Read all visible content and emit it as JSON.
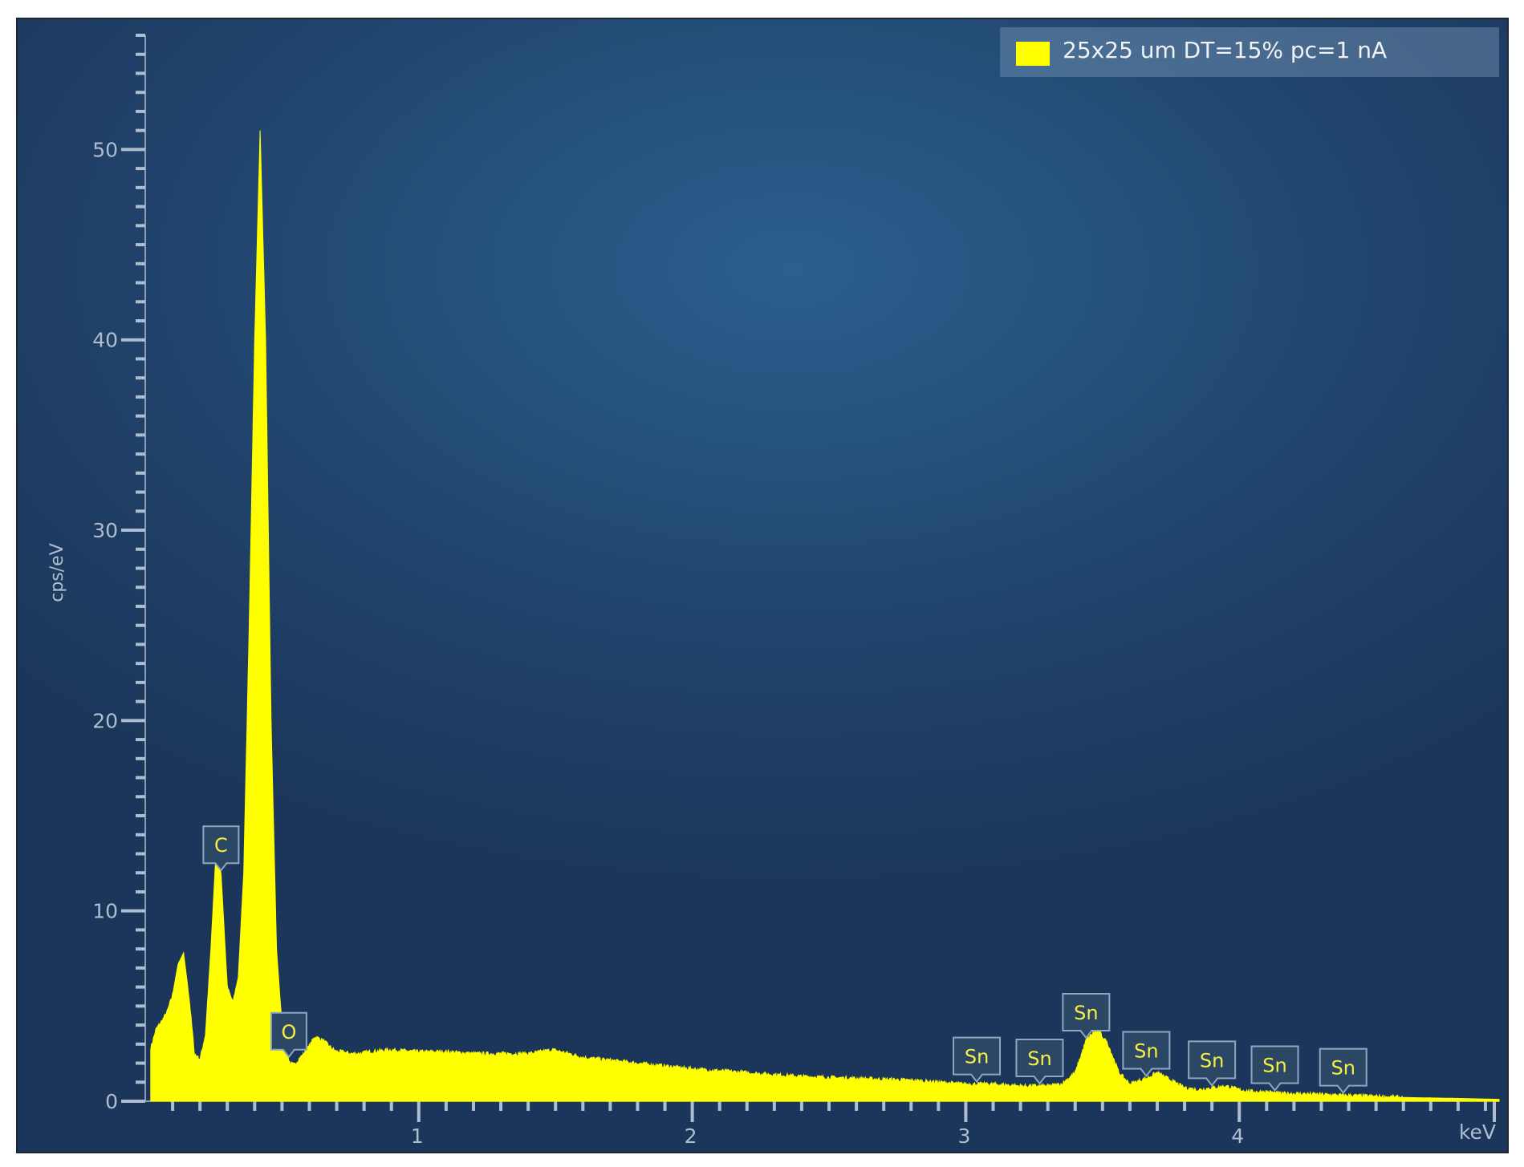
{
  "chart_data": {
    "type": "area",
    "title": "",
    "xlabel": "keV",
    "ylabel": "cps/eV",
    "xlim": [
      0,
      4.95
    ],
    "ylim": [
      0,
      56
    ],
    "x_ticks": [
      1,
      2,
      3,
      4
    ],
    "y_ticks": [
      0,
      10,
      20,
      30,
      40,
      50
    ],
    "grid": false,
    "legend_position": "top-right",
    "colors": {
      "series": "#ffff00",
      "background": "#21476e",
      "axis": "#aebed0",
      "label_border": "#8fa6c0"
    },
    "series": [
      {
        "name": "25x25 um DT=15% pc=1 nA",
        "x": [
          0.02,
          0.04,
          0.06,
          0.08,
          0.1,
          0.12,
          0.14,
          0.16,
          0.18,
          0.2,
          0.22,
          0.24,
          0.26,
          0.277,
          0.3,
          0.32,
          0.34,
          0.36,
          0.38,
          0.4,
          0.42,
          0.44,
          0.46,
          0.48,
          0.5,
          0.51,
          0.52,
          0.53,
          0.545,
          0.56,
          0.58,
          0.6,
          0.62,
          0.65,
          0.68,
          0.7,
          0.72,
          0.75,
          0.78,
          0.82,
          0.9,
          1.0,
          1.05,
          1.1,
          1.2,
          1.3,
          1.4,
          1.49,
          1.55,
          1.6,
          1.8,
          2.0,
          2.2,
          2.4,
          2.6,
          2.8,
          3.0,
          3.1,
          3.2,
          3.3,
          3.35,
          3.4,
          3.44,
          3.48,
          3.52,
          3.56,
          3.6,
          3.66,
          3.7,
          3.75,
          3.8,
          3.85,
          3.9,
          3.95,
          4.0,
          4.05,
          4.1,
          4.15,
          4.2,
          4.3,
          4.4,
          4.5,
          4.6,
          4.8,
          4.95
        ],
        "values": [
          2.8,
          3.8,
          4.2,
          4.7,
          5.6,
          7.2,
          7.8,
          5.5,
          2.5,
          2.2,
          3.5,
          8.0,
          13.5,
          12.0,
          6.0,
          5.2,
          6.5,
          12.0,
          25.0,
          40.0,
          51.0,
          40.0,
          20.0,
          8.0,
          4.0,
          3.2,
          2.4,
          2.0,
          1.9,
          2.2,
          2.5,
          2.9,
          3.4,
          3.2,
          2.8,
          2.6,
          2.6,
          2.5,
          2.5,
          2.6,
          2.7,
          2.6,
          2.6,
          2.6,
          2.5,
          2.5,
          2.5,
          2.7,
          2.5,
          2.3,
          2.0,
          1.7,
          1.5,
          1.3,
          1.2,
          1.1,
          0.9,
          0.9,
          0.8,
          0.8,
          0.9,
          1.5,
          3.2,
          3.8,
          3.0,
          1.5,
          0.9,
          1.2,
          1.5,
          1.1,
          0.7,
          0.6,
          0.7,
          0.8,
          0.6,
          0.5,
          0.5,
          0.4,
          0.4,
          0.35,
          0.3,
          0.25,
          0.2,
          0.15,
          0.1
        ]
      }
    ],
    "annotations": [
      {
        "label": "C",
        "x": 0.277
      },
      {
        "label": "O",
        "x": 0.525
      },
      {
        "label": "Sn",
        "x": 3.04
      },
      {
        "label": "Sn",
        "x": 3.27
      },
      {
        "label": "Sn",
        "x": 3.44
      },
      {
        "label": "Sn",
        "x": 3.66
      },
      {
        "label": "Sn",
        "x": 3.9
      },
      {
        "label": "Sn",
        "x": 4.13
      },
      {
        "label": "Sn",
        "x": 4.38
      }
    ]
  }
}
